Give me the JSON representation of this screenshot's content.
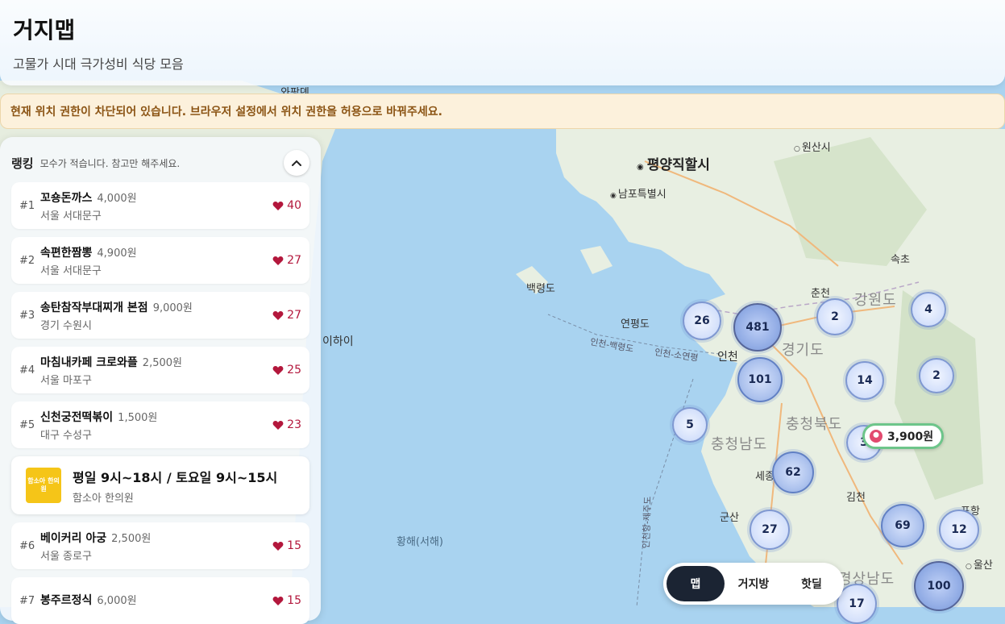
{
  "header": {
    "title": "거지맵",
    "subtitle": "고물가 시대 극가성비 식당 모음"
  },
  "banner": {
    "text": "현재 위치 권한이 차단되어 있습니다. 브라우저 설정에서 위치 권한을 허용으로 바꿔주세요."
  },
  "ranking": {
    "title": "랭킹",
    "note": "모수가 적습니다. 참고만 해주세요.",
    "items": [
      {
        "rank": "#1",
        "name": "꼬숑돈까스",
        "price": "4,000원",
        "location": "서울 서대문구",
        "likes": "40"
      },
      {
        "rank": "#2",
        "name": "속편한짬뽕",
        "price": "4,900원",
        "location": "서울 서대문구",
        "likes": "27"
      },
      {
        "rank": "#3",
        "name": "송탄참작부대찌개 본점",
        "price": "9,000원",
        "location": "경기 수원시",
        "likes": "27"
      },
      {
        "rank": "#4",
        "name": "마침내카페 크로와플",
        "price": "2,500원",
        "location": "서울 마포구",
        "likes": "25"
      },
      {
        "rank": "#5",
        "name": "신천궁전떡볶이",
        "price": "1,500원",
        "location": "대구 수성구",
        "likes": "23"
      },
      {
        "rank": "#6",
        "name": "베이커리 아궁",
        "price": "2,500원",
        "location": "서울 종로구",
        "likes": "15"
      },
      {
        "rank": "#7",
        "name": "봉주르정식",
        "price": "6,000원",
        "location": "",
        "likes": "15"
      }
    ],
    "ad": {
      "logo_text": "함소아 한의원",
      "title": "평일 9시~18시 / 토요일 9시~15시",
      "subtitle": "함소아 한의원"
    }
  },
  "map": {
    "labels": {
      "pyongyang": "평양직할시",
      "wonsan": "원산시",
      "nampo": "남포특별시",
      "baengnyeong": "백령도",
      "yeonpyeong": "연평도",
      "incheon": "인천",
      "chuncheon": "춘천",
      "gangwon": "강원도",
      "gyeonggi": "경기도",
      "sokcho": "속초",
      "chungbuk": "충청북도",
      "chungnam": "충청남도",
      "sejong": "세종",
      "gunsan": "군산",
      "gimcheon": "김천",
      "pohang": "포항",
      "ulsan": "울산",
      "gyeongnam": "경상남도",
      "yellow_sea": "황해(서해)",
      "weihai": "이하이",
      "route1": "인천-백령도",
      "route2": "인천-소연평",
      "route3": "인천항-제주도",
      "top_partial": "와팡뎬"
    },
    "clusters": [
      "26",
      "481",
      "101",
      "2",
      "4",
      "14",
      "2",
      "5",
      "62",
      "27",
      "69",
      "12",
      "100",
      "17",
      "3"
    ],
    "price_pin": "3,900원"
  },
  "nav": {
    "map": "맵",
    "room": "거지방",
    "hot": "핫딜"
  },
  "colors": {
    "sea": "#a9d3f0",
    "land": "#e9efe4",
    "accent_dark": "#1b2433",
    "heart": "#b3173c",
    "pin_border": "#6dc58a"
  }
}
